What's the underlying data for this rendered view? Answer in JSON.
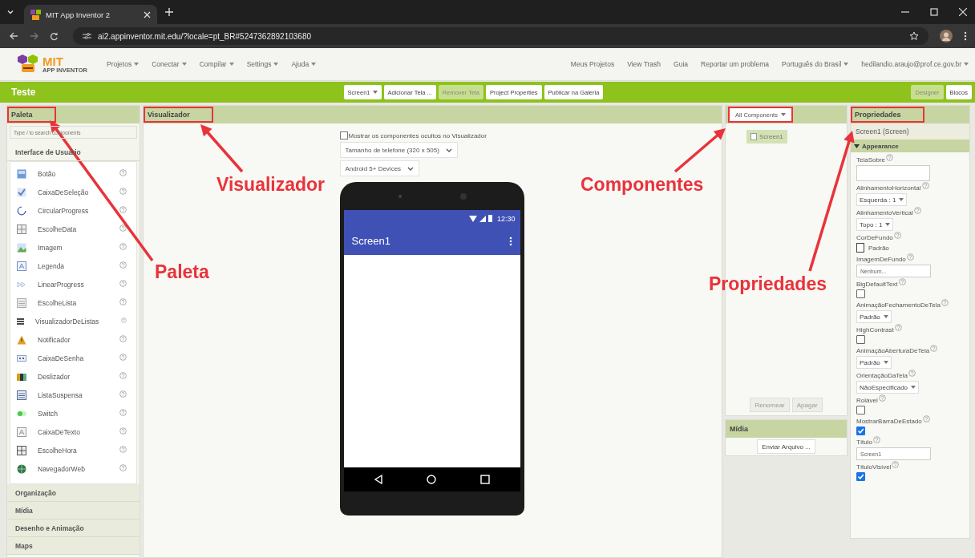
{
  "browser": {
    "tab_title": "MIT App Inventor 2",
    "url": "ai2.appinventor.mit.edu/?locale=pt_BR#5247362892103680"
  },
  "menu": {
    "logo_title": "MIT",
    "logo_subtitle": "APP INVENTOR",
    "left": [
      {
        "label": "Projetos",
        "dropdown": true
      },
      {
        "label": "Conectar",
        "dropdown": true
      },
      {
        "label": "Compilar",
        "dropdown": true
      },
      {
        "label": "Settings",
        "dropdown": true
      },
      {
        "label": "Ajuda",
        "dropdown": true
      }
    ],
    "right": [
      {
        "label": "Meus Projetos",
        "dropdown": false
      },
      {
        "label": "View Trash",
        "dropdown": false
      },
      {
        "label": "Guia",
        "dropdown": false
      },
      {
        "label": "Reportar um problema",
        "dropdown": false
      },
      {
        "label": "Português do Brasil",
        "dropdown": true
      },
      {
        "label": "hedilandio.araujo@prof.ce.gov.br",
        "dropdown": true
      }
    ]
  },
  "toolbar": {
    "project": "Teste",
    "buttons": [
      {
        "label": "Screen1",
        "dropdown": true,
        "disabled": false
      },
      {
        "label": "Adicionar Tela ...",
        "dropdown": false,
        "disabled": false
      },
      {
        "label": "Remover Tela",
        "dropdown": false,
        "disabled": true
      },
      {
        "label": "Project Properties",
        "dropdown": false,
        "disabled": false
      },
      {
        "label": "Publicar na Galeria",
        "dropdown": false,
        "disabled": false
      }
    ],
    "views": [
      {
        "label": "Designer",
        "selected": true
      },
      {
        "label": "Blocos",
        "selected": false
      }
    ]
  },
  "palette": {
    "title": "Paleta",
    "highlighted": true,
    "search_placeholder": "Type / to search components",
    "categories": [
      {
        "label": "Interface de Usuário",
        "expanded": true,
        "items": [
          "Botão",
          "CaixaDeSeleção",
          "CircularProgress",
          "EscolheData",
          "Imagem",
          "Legenda",
          "LinearProgress",
          "EscolheLista",
          "VisualizadorDeListas",
          "Notificador",
          "CaixaDeSenha",
          "Deslizador",
          "ListaSuspensa",
          "Switch",
          "CaixaDeTexto",
          "EscolheHora",
          "NavegadorWeb"
        ]
      },
      {
        "label": "Organização",
        "expanded": false
      },
      {
        "label": "Mídia",
        "expanded": false
      },
      {
        "label": "Desenho e Animação",
        "expanded": false
      },
      {
        "label": "Maps",
        "expanded": false
      }
    ]
  },
  "viewer": {
    "title": "Visualizador",
    "highlighted": true,
    "show_hidden": {
      "label": "Mostrar os componentes ocultos no Visualizador",
      "checked": false
    },
    "selects": [
      "Tamanho de telefone (320 x 505)",
      "Android 5+ Devices"
    ],
    "phone": {
      "time": "12:30",
      "screen_title": "Screen1"
    }
  },
  "components": {
    "filter": "All Components",
    "highlighted": true,
    "tree": [
      {
        "label": "Screen1",
        "selected": true
      }
    ],
    "buttons": [
      {
        "label": "Renomear",
        "disabled": true
      },
      {
        "label": "Apagar",
        "disabled": true
      }
    ]
  },
  "media": {
    "title": "Mídia",
    "upload_button": "Enviar Arquivo ..."
  },
  "properties": {
    "title": "Propriedades",
    "highlighted": true,
    "component": "Screen1 (Screen)",
    "group": {
      "label": "Appearance",
      "expanded": true
    },
    "items": [
      {
        "kind": "textarea",
        "label": "TelaSobre"
      },
      {
        "kind": "select",
        "label": "AlinhamentoHorizontal",
        "value": "Esquerda : 1"
      },
      {
        "kind": "select",
        "label": "AlinhamentoVertical",
        "value": "Topo : 1"
      },
      {
        "kind": "color",
        "label": "CorDeFundo",
        "value": "Padrão"
      },
      {
        "kind": "text",
        "label": "ImagemDeFundo",
        "value": "Nenhum..."
      },
      {
        "kind": "checkbox",
        "label": "BigDefaultText",
        "checked": false
      },
      {
        "kind": "select",
        "label": "AnimaçãoFechamentoDeTela",
        "value": "Padrão"
      },
      {
        "kind": "checkbox",
        "label": "HighContrast",
        "checked": false
      },
      {
        "kind": "select",
        "label": "AnimaçãoAberturaDeTela",
        "value": "Padrão"
      },
      {
        "kind": "select",
        "label": "OrientaçãoDaTela",
        "value": "NãoEspecificado"
      },
      {
        "kind": "checkbox",
        "label": "Rolável",
        "checked": false
      },
      {
        "kind": "checkbox",
        "label": "MostrarBarraDeEstado",
        "checked": true
      },
      {
        "kind": "text",
        "label": "Título",
        "value": "Screen1"
      },
      {
        "kind": "checkbox",
        "label": "TítuloVisível",
        "checked": true
      }
    ]
  },
  "annotations": [
    {
      "text": "Visualizador"
    },
    {
      "text": "Paleta"
    },
    {
      "text": "Componentes"
    },
    {
      "text": "Propriedades"
    }
  ]
}
